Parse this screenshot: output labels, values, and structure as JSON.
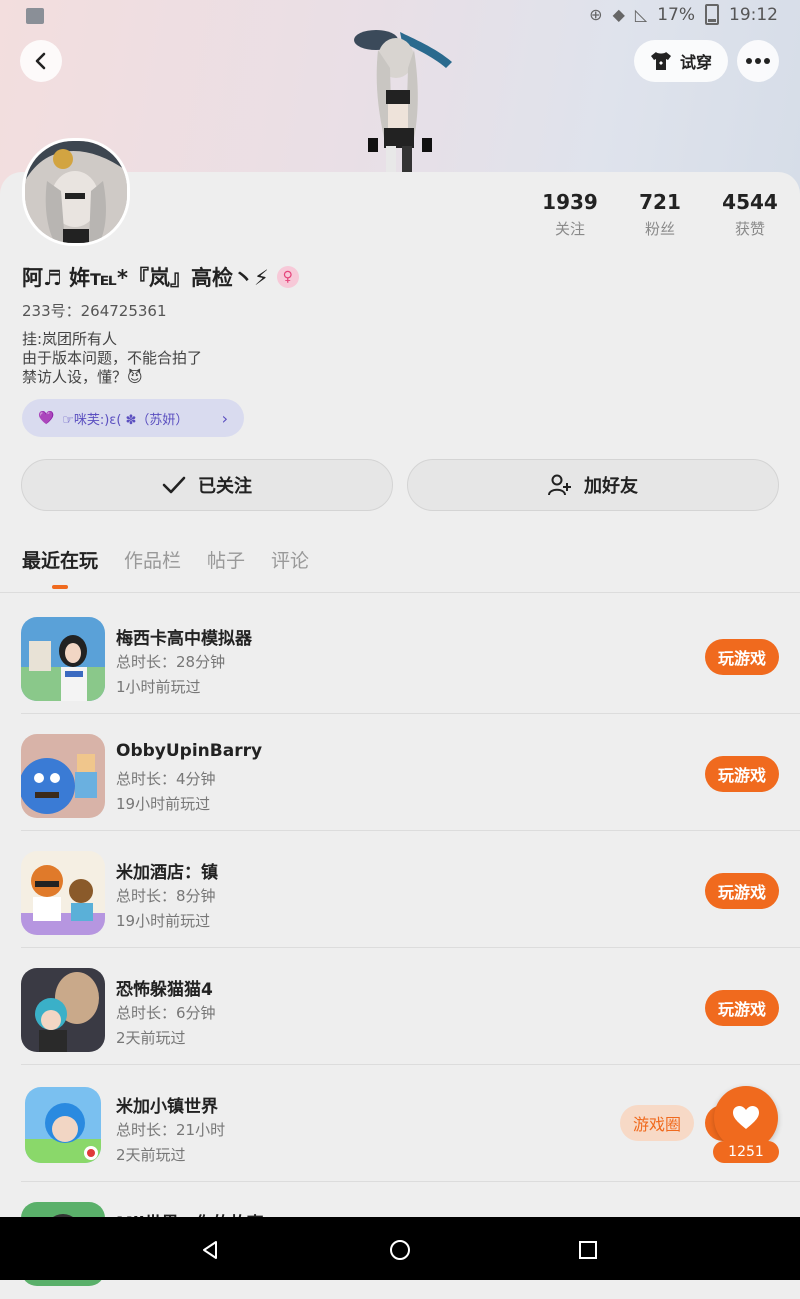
{
  "status_bar": {
    "battery_text": "17%",
    "time": "19:12"
  },
  "header": {
    "try_on_label": "试穿"
  },
  "profile": {
    "stats": [
      {
        "value": "1939",
        "label": "关注"
      },
      {
        "value": "721",
        "label": "粉丝"
      },
      {
        "value": "4544",
        "label": "获赞"
      }
    ],
    "nickname": "阿♬ 姩℡*『岚』高检丶⚡",
    "gender_symbol": "♀",
    "uid_text": "233号：264725361",
    "bio_lines": [
      "挂:岚团所有人",
      "由于版本问题，不能合拍了",
      "禁访人设，懂？😈"
    ],
    "club_badge": {
      "heart": "💜",
      "text": "☞咪芙:)ɛ( ✽（苏妍）"
    },
    "follow_label": "已关注",
    "add_friend_label": "加好友"
  },
  "tabs": [
    {
      "label": "最近在玩",
      "active": true
    },
    {
      "label": "作品栏",
      "active": false
    },
    {
      "label": "帖子",
      "active": false
    },
    {
      "label": "评论",
      "active": false
    }
  ],
  "games": [
    {
      "name": "梅西卡高中模拟器",
      "duration": "总时长：28分钟",
      "last_played": "1小时前玩过",
      "action": "玩游戏"
    },
    {
      "name": "ObbyUpinBarry",
      "duration": "总时长：4分钟",
      "last_played": "19小时前玩过",
      "action": "玩游戏"
    },
    {
      "name": "米加酒店：镇",
      "duration": "总时长：8分钟",
      "last_played": "19小时前玩过",
      "action": "玩游戏"
    },
    {
      "name": "恐怖躲猫猫4",
      "duration": "总时长：6分钟",
      "last_played": "2天前玩过",
      "action": "玩游戏"
    },
    {
      "name": "米加小镇世界",
      "duration": "总时长：21小时",
      "last_played": "2天前玩过",
      "action": "游戏圈"
    },
    {
      "name": "Mii世界：你的故事",
      "duration": "",
      "last_played": "",
      "action": ""
    }
  ],
  "like_count": "1251",
  "colors": {
    "accent": "#f06a1e",
    "club_text": "#5b4fc0",
    "club_bg": "#d9dbef"
  }
}
